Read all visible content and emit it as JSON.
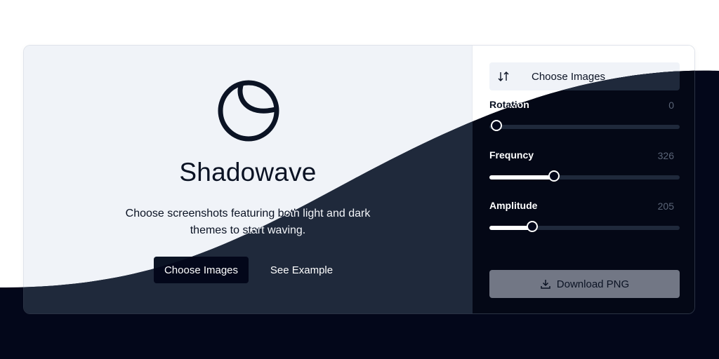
{
  "hero": {
    "title": "Shadowave",
    "description": "Choose screenshots featuring both light and dark themes to start waving.",
    "choose_images_label": "Choose Images",
    "see_example_label": "See Example"
  },
  "sidebar": {
    "choose_images_label": "Choose Images",
    "sliders": [
      {
        "label": "Rotation",
        "value": "0",
        "fraction": 0.0
      },
      {
        "label": "Frequncy",
        "value": "326",
        "fraction": 0.34
      },
      {
        "label": "Amplitude",
        "value": "205",
        "fraction": 0.225
      }
    ],
    "download_label": "Download PNG"
  },
  "colors": {
    "dark_bg": "#03071a",
    "light_panel": "#f0f3f8",
    "dark_panel": "#1f293b",
    "accent_dark": "#0b1324"
  }
}
